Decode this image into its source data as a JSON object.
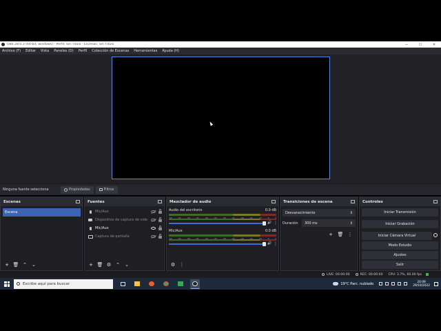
{
  "window": {
    "title": "OBS 28.0.3 (64-bit, windows) - Perfil: Sin Título - Escenas: Sin Título"
  },
  "menu": [
    "Archivo (F)",
    "Editar",
    "Vista",
    "Paneles (D)",
    "Perfil",
    "Colección de Escenas",
    "Herramientas",
    "Ayuda (H)"
  ],
  "source_toolbar": {
    "no_source": "Ninguna fuente selecciona",
    "properties": "Propiedades",
    "filters": "Filtros"
  },
  "scenes": {
    "title": "Escenas",
    "items": [
      "Escena"
    ]
  },
  "sources": {
    "title": "Fuentes",
    "items": [
      {
        "name": "Mic/Aux",
        "icon": "microphone-icon",
        "visible": false
      },
      {
        "name": "Dispositivo de captura de vide",
        "icon": "camera-icon",
        "visible": false
      },
      {
        "name": "Mic/Aux",
        "icon": "microphone-icon",
        "visible": true
      },
      {
        "name": "Captura de pantalla",
        "icon": "monitor-icon",
        "visible": false
      }
    ]
  },
  "mixer": {
    "title": "Mezclador de audio",
    "ticks": [
      "-60",
      "-55",
      "-50",
      "-45",
      "-40",
      "-35",
      "-30",
      "-25",
      "-20",
      "-15",
      "-10",
      "-5",
      "0"
    ],
    "channels": [
      {
        "name": "Audio del escritorio",
        "level": "0.0 dB",
        "volume": 1.0
      },
      {
        "name": "Mic/Aux",
        "level": "0.0 dB",
        "volume": 1.0
      }
    ]
  },
  "transitions": {
    "title": "Transiciones de escena",
    "selected": "Desvanecimiento",
    "duration_label": "Duración",
    "duration_value": "300 ms"
  },
  "controls": {
    "title": "Controles",
    "start_stream": "Iniciar Transmisión",
    "start_record": "Iniciar Grabación",
    "virtual_cam": "Iniciar Cámara Virtual",
    "studio_mode": "Modo Estudio",
    "settings": "Ajustes",
    "exit": "Salir"
  },
  "status": {
    "live": "LIVE: 00:00:00",
    "rec": "REC: 00:00:00",
    "cpu": "CPU: 3.7%, 60.00 fps"
  },
  "taskbar": {
    "search_placeholder": "Escribe aquí para buscar",
    "weather": "19°C  Parc. nublado",
    "time": "20:09",
    "date": "29/10/2022"
  },
  "colors": {
    "accent": "#3c63b4",
    "preview_border": "#5a86d6",
    "dock_bg": "#1e1e23",
    "taskbar_bg": "#1e2a3a"
  }
}
